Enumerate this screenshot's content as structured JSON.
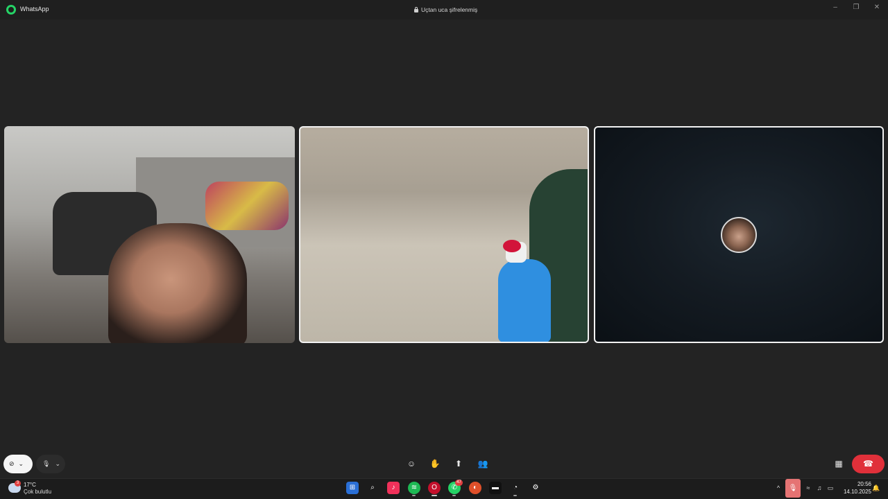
{
  "titlebar": {
    "app_name": "WhatsApp",
    "encryption_label": "Uçtan uca şifrelenmiş"
  },
  "call": {
    "participants": [
      {
        "video": "on"
      },
      {
        "video": "on",
        "active_speaker": true
      },
      {
        "video": "off",
        "avatar": true
      }
    ],
    "accent_color": "#e0303a"
  },
  "controls": {
    "camera_icon": "camera-off-icon",
    "mic_icon": "microphone-icon",
    "center_icons": [
      "emoji-icon",
      "raise-hand-icon",
      "share-screen-icon",
      "participants-icon"
    ],
    "layout_icon": "grid-layout-icon",
    "end_call_icon": "hang-up-icon"
  },
  "taskbar": {
    "weather": {
      "temp": "17°C",
      "desc": "Çok bulutlu",
      "badge": "3"
    },
    "apps": [
      {
        "name": "start-icon"
      },
      {
        "name": "search-icon"
      },
      {
        "name": "music-icon"
      },
      {
        "name": "spotify-icon"
      },
      {
        "name": "opera-icon"
      },
      {
        "name": "whatsapp-icon",
        "badge": "47"
      },
      {
        "name": "app-icon"
      },
      {
        "name": "terminal-icon"
      },
      {
        "name": "app-icon-2"
      },
      {
        "name": "settings-icon"
      }
    ],
    "clock": {
      "time": "20:56",
      "date": "14.10.2025"
    }
  }
}
